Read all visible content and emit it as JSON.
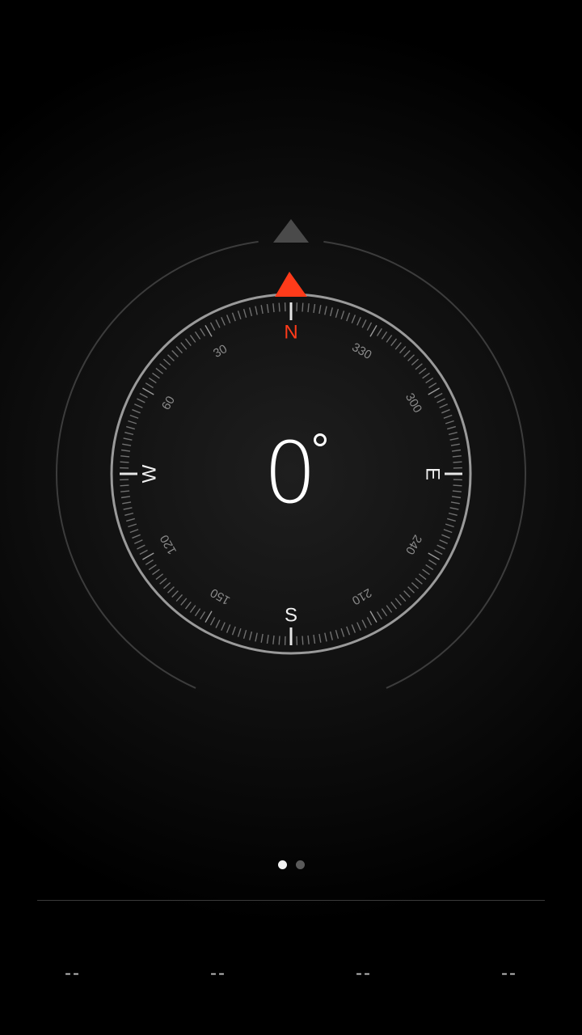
{
  "compass": {
    "heading_value": "0",
    "cardinals": {
      "north": "N",
      "east": "E",
      "south": "S",
      "west": "W"
    },
    "degree_labels": [
      "30",
      "60",
      "120",
      "150",
      "210",
      "240",
      "300",
      "330"
    ],
    "north_marker_color": "#ff3b1a",
    "reference_marker_color": "#4a4a4a"
  },
  "pager": {
    "pages": 2,
    "active": 0
  },
  "stats": {
    "values": [
      "--",
      "--",
      "--",
      "--"
    ]
  }
}
